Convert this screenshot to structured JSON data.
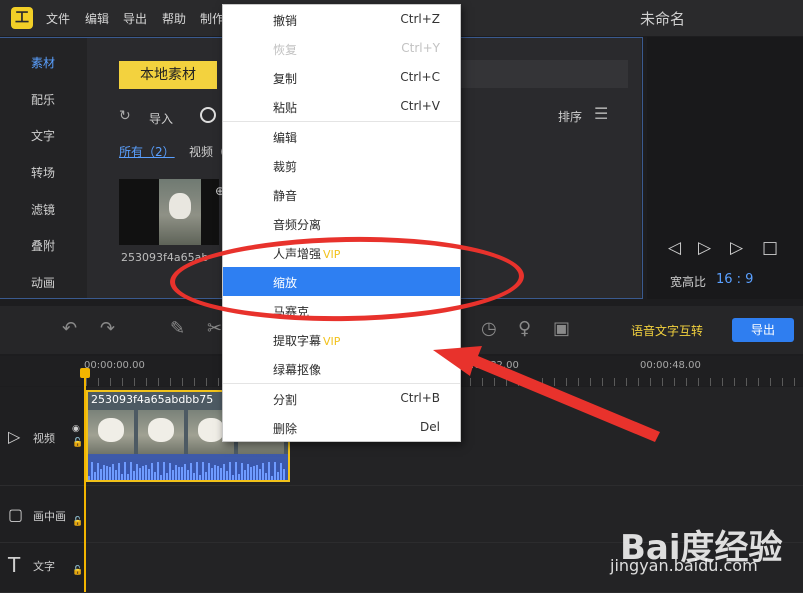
{
  "titlebar": {
    "logo_text": "工",
    "menus": [
      "文件",
      "编辑",
      "导出",
      "帮助",
      "制作"
    ],
    "doc_title": "未命名"
  },
  "sidebar": {
    "items": [
      {
        "label": "素材",
        "active": true
      },
      {
        "label": "配乐"
      },
      {
        "label": "文字"
      },
      {
        "label": "转场"
      },
      {
        "label": "滤镜"
      },
      {
        "label": "叠附"
      },
      {
        "label": "动画"
      }
    ]
  },
  "media": {
    "local_button": "本地素材",
    "import_label": "导入",
    "sort_label": "排序",
    "filter_all": "所有（2）",
    "filter_video": "视频（",
    "thumb_name": "253093f4a65ab",
    "accent": "#5aa0ff"
  },
  "preview": {
    "ratio_label": "宽高比",
    "ratio_value": "16 : 9"
  },
  "toolbar": {
    "voice_text": "语音文字互转",
    "export_label": "导出"
  },
  "timeline": {
    "timecodes": [
      "00:00:00.00",
      "00:00:32.00",
      "00:00:48.00"
    ],
    "clip_name": "253093f4a65abdbb75",
    "tracks": [
      {
        "label": "视频"
      },
      {
        "label": "画中画"
      },
      {
        "label": "文字"
      }
    ]
  },
  "context_menu": {
    "items": [
      {
        "label": "撤销",
        "shortcut": "Ctrl+Z"
      },
      {
        "label": "恢复",
        "shortcut": "Ctrl+Y",
        "disabled": true
      },
      {
        "label": "复制",
        "shortcut": "Ctrl+C"
      },
      {
        "label": "粘贴",
        "shortcut": "Ctrl+V"
      },
      {
        "label": "编辑",
        "shortcut": ""
      },
      {
        "label": "裁剪",
        "shortcut": ""
      },
      {
        "label": "静音",
        "shortcut": ""
      },
      {
        "label": "音频分离",
        "shortcut": ""
      },
      {
        "label": "人声增强",
        "shortcut": "",
        "vip": "VIP"
      },
      {
        "label": "缩放",
        "shortcut": "",
        "active": true
      },
      {
        "label": "马赛克",
        "shortcut": ""
      },
      {
        "label": "提取字幕",
        "shortcut": "",
        "vip": "VIP"
      },
      {
        "label": "绿幕抠像",
        "shortcut": ""
      },
      {
        "label": "分割",
        "shortcut": "Ctrl+B"
      },
      {
        "label": "删除",
        "shortcut": "Del"
      }
    ],
    "active_color": "#2e7ff2"
  },
  "watermark": {
    "logo": "Bai度经验",
    "url": "jingyan.baidu.com"
  },
  "annotation_color": "#e8322c"
}
